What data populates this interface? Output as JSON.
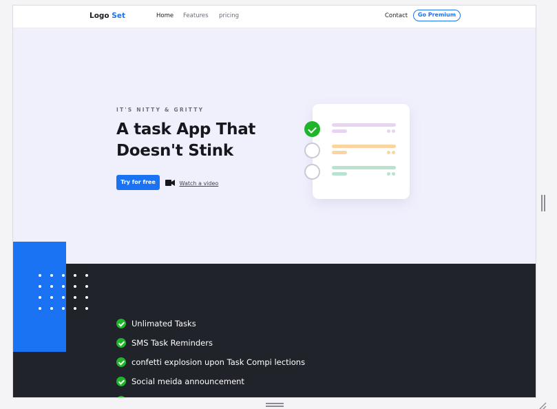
{
  "nav": {
    "logo_main": "Logo",
    "logo_accent": "Set",
    "links": [
      "Home",
      "Features",
      "pricing"
    ],
    "contact": "Contact",
    "premium_button": "Go Premium"
  },
  "hero": {
    "eyebrow": "IT'S NITTY & GRITTY",
    "headline": "A task App That Doesn't Stink",
    "cta_button": "Try for free",
    "video_link": "Watch a video"
  },
  "task_card": {
    "tasks": [
      {
        "done": true,
        "color": "#e7d3f4"
      },
      {
        "done": false,
        "color": "#fbd4a1"
      },
      {
        "done": false,
        "color": "#b9e3cf"
      }
    ]
  },
  "features": [
    "Unlimated Tasks",
    "SMS Task Reminders",
    "confetti explosion upon Task Compi lections",
    "Social meida announcement"
  ],
  "colors": {
    "accent": "#1a73f2",
    "hero_bg": "#f0f0fd",
    "dark_bg": "#20232a",
    "check_green": "#1fb52b"
  }
}
